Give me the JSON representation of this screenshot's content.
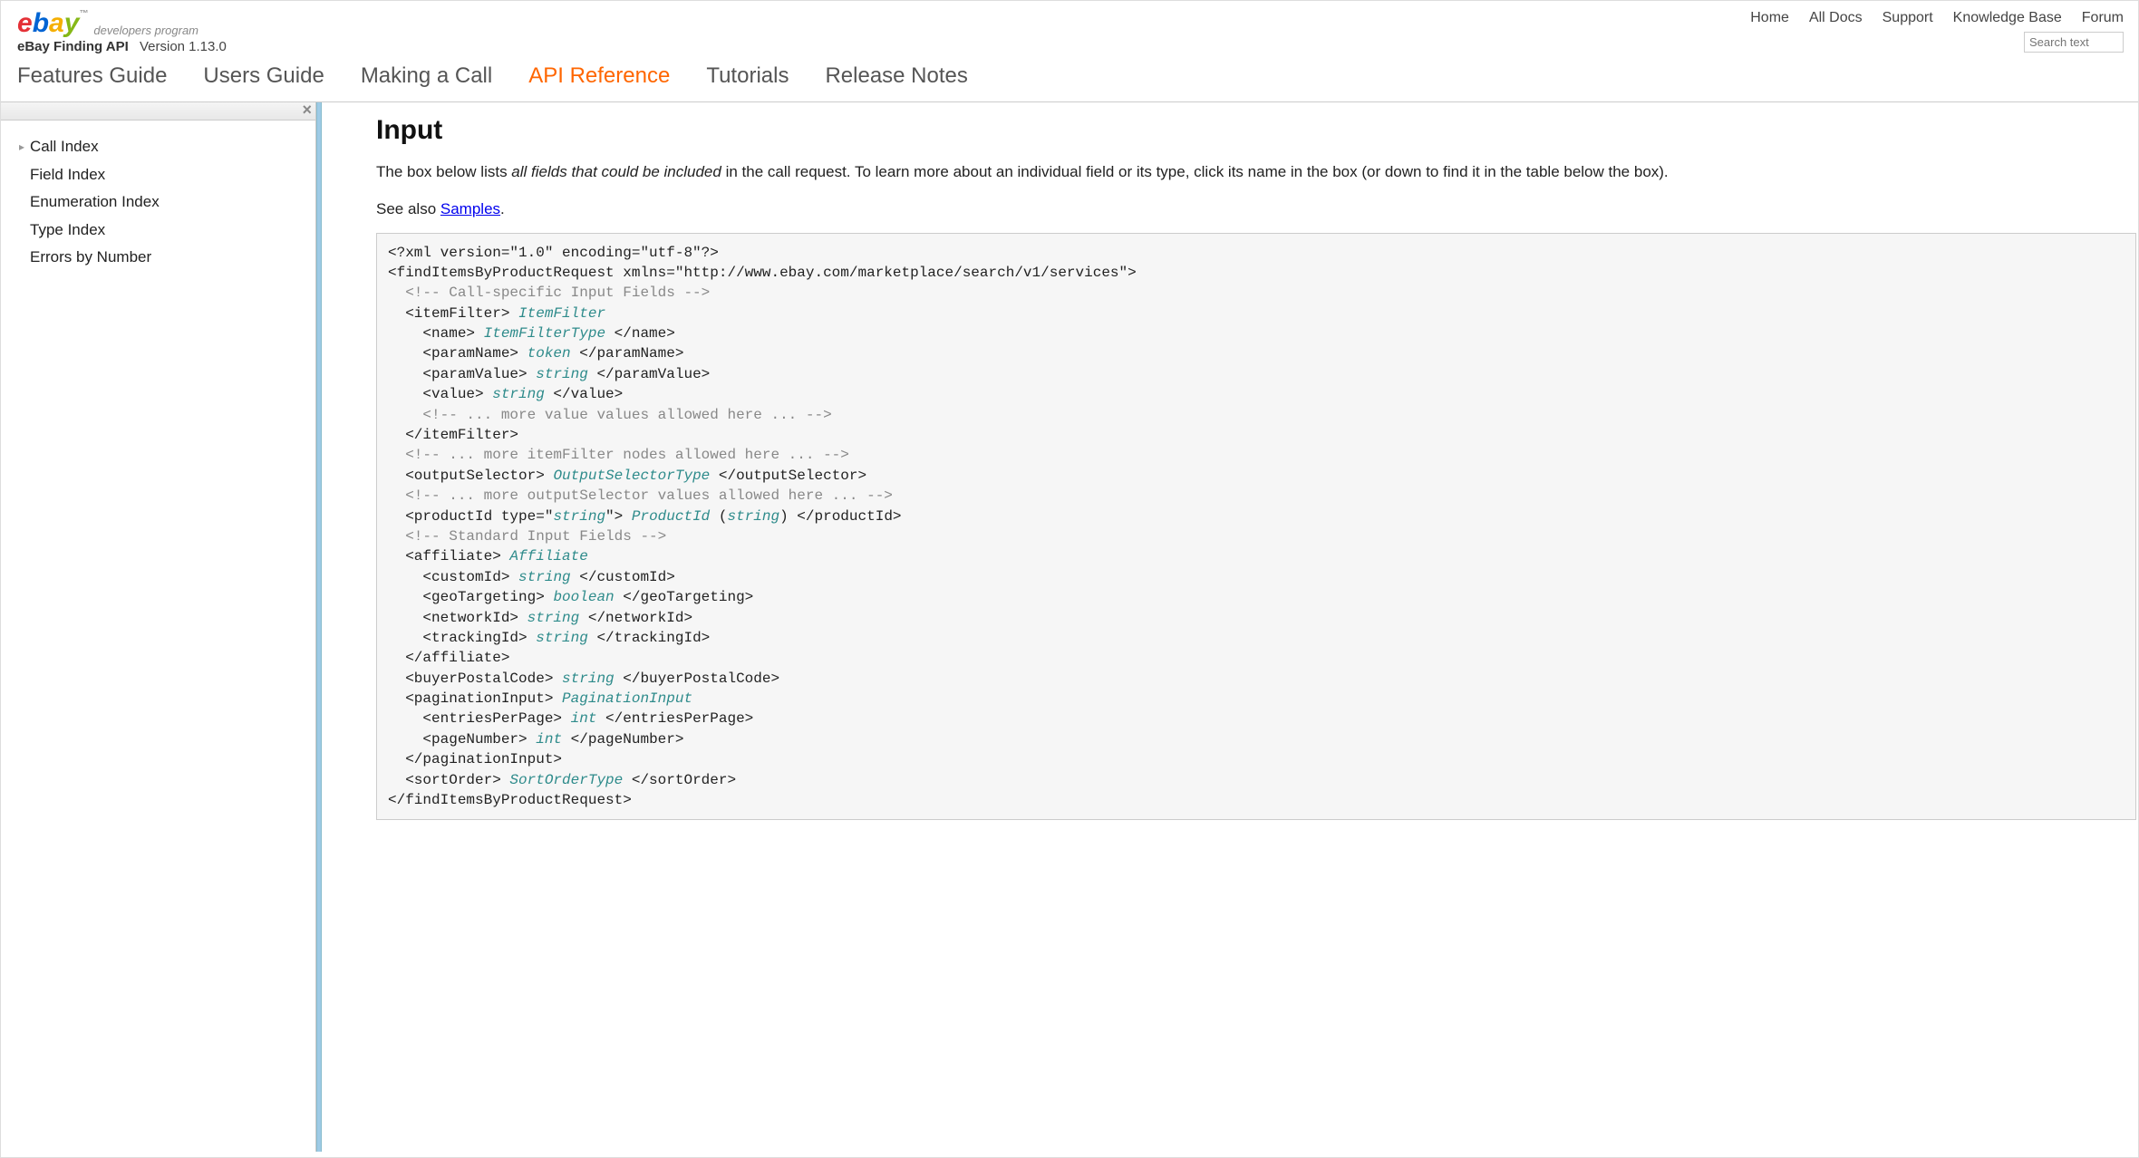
{
  "brand": {
    "logo_sub": "developers program",
    "api_name": "eBay Finding API",
    "version": "Version 1.13.0"
  },
  "top_nav": {
    "home": "Home",
    "all_docs": "All Docs",
    "support": "Support",
    "kb": "Knowledge Base",
    "forum": "Forum"
  },
  "search": {
    "placeholder": "Search text"
  },
  "main_tabs": {
    "features": "Features Guide",
    "users": "Users Guide",
    "making_call": "Making a Call",
    "api_ref": "API Reference",
    "tutorials": "Tutorials",
    "release_notes": "Release Notes"
  },
  "sidebar": {
    "items": [
      "Call Index",
      "Field Index",
      "Enumeration Index",
      "Type Index",
      "Errors by Number"
    ]
  },
  "content": {
    "heading": "Input",
    "intro_pre": "The box below lists ",
    "intro_em": "all fields that could be included",
    "intro_post": " in the call request. To learn more about an individual field or its type, click its name in the box (or down to find it in the table below the box).",
    "see_also_pre": "See also ",
    "see_also_link": "Samples",
    "see_also_post": "."
  },
  "code": {
    "l01": "<?xml version=\"1.0\" encoding=\"utf-8\"?>",
    "l02": "<findItemsByProductRequest xmlns=\"http://www.ebay.com/marketplace/search/v1/services\">",
    "l03a": "  <!-- Call-specific Input Fields -->",
    "l04a": "  <itemFilter> ",
    "l04t": "ItemFilter",
    "l05a": "    <name> ",
    "l05t": "ItemFilterType",
    "l05b": " </name>",
    "l06a": "    <paramName> ",
    "l06t": "token",
    "l06b": " </paramName>",
    "l07a": "    <paramValue> ",
    "l07t": "string",
    "l07b": " </paramValue>",
    "l08a": "    <value> ",
    "l08t": "string",
    "l08b": " </value>",
    "l09": "    <!-- ... more value values allowed here ... -->",
    "l10": "  </itemFilter>",
    "l11": "  <!-- ... more itemFilter nodes allowed here ... -->",
    "l12a": "  <outputSelector> ",
    "l12t": "OutputSelectorType",
    "l12b": " </outputSelector>",
    "l13": "  <!-- ... more outputSelector values allowed here ... -->",
    "l14a": "  <productId type=\"",
    "l14t1": "string",
    "l14b": "\"> ",
    "l14t2": "ProductId",
    "l14c": " (",
    "l14t3": "string",
    "l14d": ") </productId>",
    "l15": "  <!-- Standard Input Fields -->",
    "l16a": "  <affiliate> ",
    "l16t": "Affiliate",
    "l17a": "    <customId> ",
    "l17t": "string",
    "l17b": " </customId>",
    "l18a": "    <geoTargeting> ",
    "l18t": "boolean",
    "l18b": " </geoTargeting>",
    "l19a": "    <networkId> ",
    "l19t": "string",
    "l19b": " </networkId>",
    "l20a": "    <trackingId> ",
    "l20t": "string",
    "l20b": " </trackingId>",
    "l21": "  </affiliate>",
    "l22a": "  <buyerPostalCode> ",
    "l22t": "string",
    "l22b": " </buyerPostalCode>",
    "l23a": "  <paginationInput> ",
    "l23t": "PaginationInput",
    "l24a": "    <entriesPerPage> ",
    "l24t": "int",
    "l24b": " </entriesPerPage>",
    "l25a": "    <pageNumber> ",
    "l25t": "int",
    "l25b": " </pageNumber>",
    "l26": "  </paginationInput>",
    "l27a": "  <sortOrder> ",
    "l27t": "SortOrderType",
    "l27b": " </sortOrder>",
    "l28": "</findItemsByProductRequest>"
  }
}
